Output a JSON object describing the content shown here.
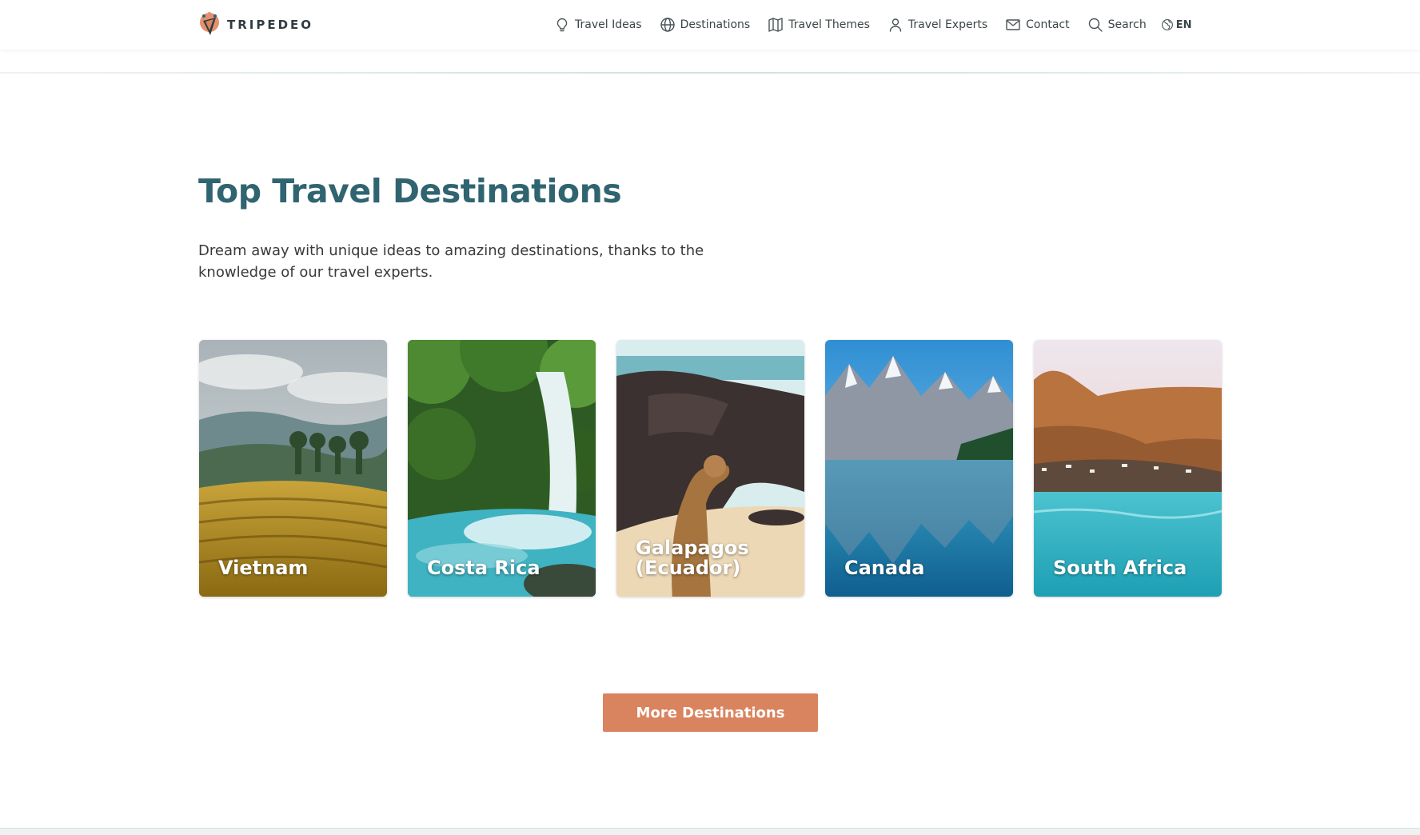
{
  "brand": {
    "name": "TRIPEDEO"
  },
  "nav": {
    "items": [
      {
        "label": "Travel Ideas",
        "icon": "lightbulb-icon"
      },
      {
        "label": "Destinations",
        "icon": "globe-icon"
      },
      {
        "label": "Travel Themes",
        "icon": "map-icon"
      },
      {
        "label": "Travel Experts",
        "icon": "person-icon"
      },
      {
        "label": "Contact",
        "icon": "envelope-icon"
      },
      {
        "label": "Search",
        "icon": "search-icon"
      }
    ],
    "language": {
      "label": "EN",
      "icon": "earth-icon"
    }
  },
  "main": {
    "title": "Top Travel Destinations",
    "intro": "Dream away with unique ideas to amazing destinations, thanks to the knowledge of our travel experts.",
    "destinations": [
      {
        "label": "Vietnam",
        "image": "rice terraces and mountains"
      },
      {
        "label": "Costa Rica",
        "image": "waterfall in rainforest"
      },
      {
        "label": "Galapagos (Ecuador)",
        "image": "sea lion on beach"
      },
      {
        "label": "Canada",
        "image": "mountain lake reflection"
      },
      {
        "label": "South Africa",
        "image": "coastal town under mountains"
      }
    ],
    "cta_label": "More Destinations"
  },
  "colors": {
    "title": "#2f6470",
    "cta": "#d9845f",
    "nav_text": "#3b4448"
  }
}
